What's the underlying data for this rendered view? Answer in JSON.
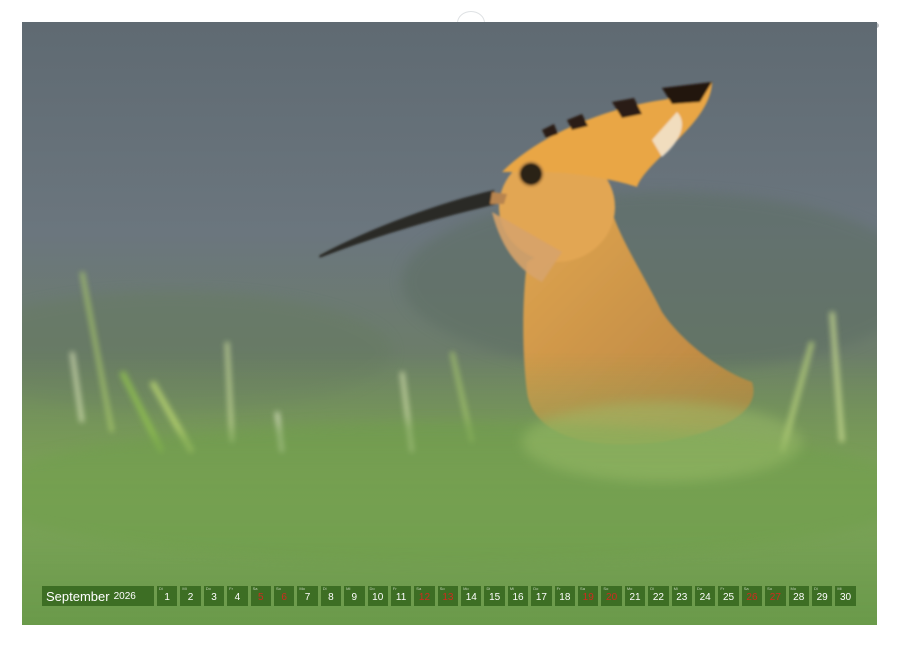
{
  "calendar": {
    "month": "September",
    "year": "2026",
    "days": [
      {
        "num": "1",
        "dn": "Di",
        "weekend": false
      },
      {
        "num": "2",
        "dn": "Mi",
        "weekend": false
      },
      {
        "num": "3",
        "dn": "Do",
        "weekend": false
      },
      {
        "num": "4",
        "dn": "Fr",
        "weekend": false
      },
      {
        "num": "5",
        "dn": "Sa",
        "weekend": true
      },
      {
        "num": "6",
        "dn": "So",
        "weekend": true
      },
      {
        "num": "7",
        "dn": "Mo",
        "weekend": false
      },
      {
        "num": "8",
        "dn": "Di",
        "weekend": false
      },
      {
        "num": "9",
        "dn": "Mi",
        "weekend": false
      },
      {
        "num": "10",
        "dn": "Do",
        "weekend": false
      },
      {
        "num": "11",
        "dn": "Fr",
        "weekend": false
      },
      {
        "num": "12",
        "dn": "Sa",
        "weekend": true
      },
      {
        "num": "13",
        "dn": "So",
        "weekend": true
      },
      {
        "num": "14",
        "dn": "Mo",
        "weekend": false
      },
      {
        "num": "15",
        "dn": "Di",
        "weekend": false
      },
      {
        "num": "16",
        "dn": "Mi",
        "weekend": false
      },
      {
        "num": "17",
        "dn": "Do",
        "weekend": false
      },
      {
        "num": "18",
        "dn": "Fr",
        "weekend": false
      },
      {
        "num": "19",
        "dn": "Sa",
        "weekend": true
      },
      {
        "num": "20",
        "dn": "So",
        "weekend": true
      },
      {
        "num": "21",
        "dn": "Mo",
        "weekend": false
      },
      {
        "num": "22",
        "dn": "Di",
        "weekend": false
      },
      {
        "num": "23",
        "dn": "Mi",
        "weekend": false
      },
      {
        "num": "24",
        "dn": "Do",
        "weekend": false
      },
      {
        "num": "25",
        "dn": "Fr",
        "weekend": false
      },
      {
        "num": "26",
        "dn": "Sa",
        "weekend": true
      },
      {
        "num": "27",
        "dn": "So",
        "weekend": true
      },
      {
        "num": "28",
        "dn": "Mo",
        "weekend": false
      },
      {
        "num": "29",
        "dn": "Di",
        "weekend": false
      },
      {
        "num": "30",
        "dn": "Mi",
        "weekend": false
      }
    ]
  },
  "colors": {
    "strip_bg": "#3d6e24",
    "weekday_text": "#ffffff",
    "weekend_text": "#d12a1e",
    "binding_dot": "#b8bcc0"
  },
  "photo": {
    "icon": "hoopoe-bird-photo"
  }
}
